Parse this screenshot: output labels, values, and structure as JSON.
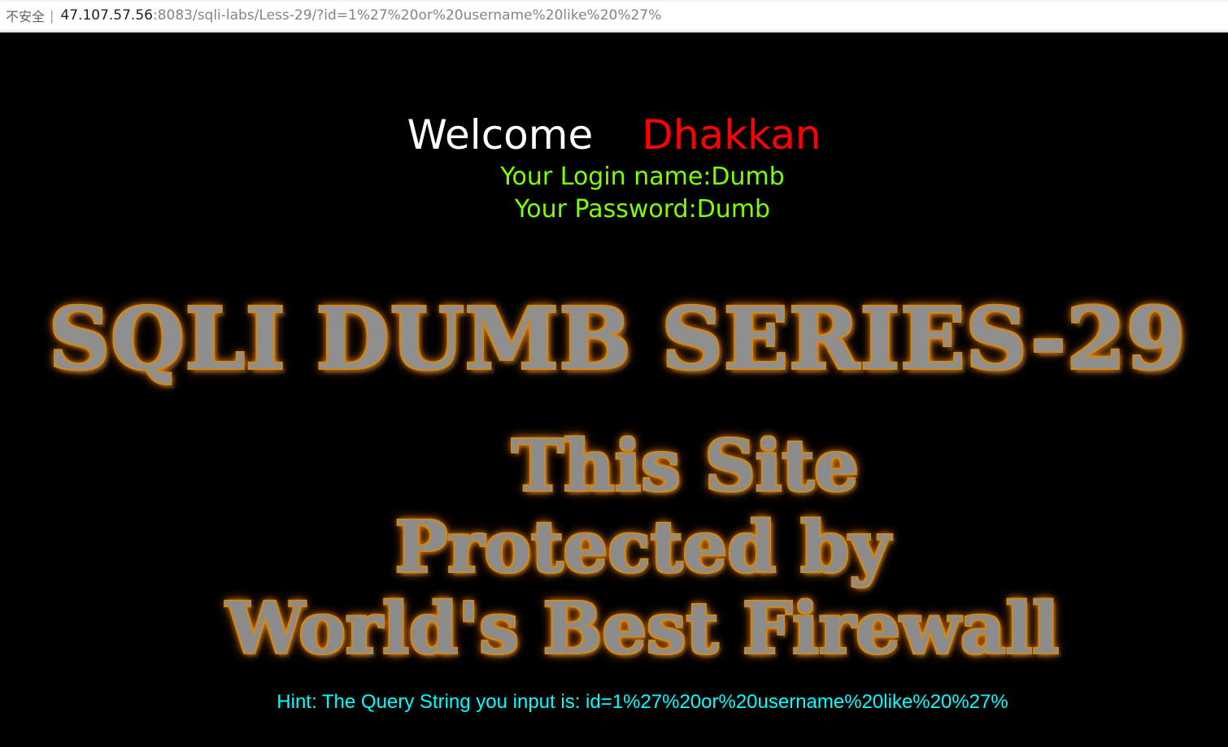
{
  "browser": {
    "security_label": "不安全",
    "separator": "|",
    "url_host": "47.107.57.56",
    "url_rest": ":8083/sqli-labs/Less-29/?id=1%27%20or%20username%20like%20%27%"
  },
  "page": {
    "welcome_word": "Welcome",
    "welcome_name": "Dhakkan",
    "login_name": "Your Login name:Dumb",
    "password": "Your Password:Dumb",
    "title": "SQLI DUMB SERIES-29",
    "protect_lines": [
      "This Site",
      "Protected by",
      "World's Best Firewall"
    ],
    "hint": "Hint: The Query String you input is: id=1%27%20or%20username%20like%20%27%"
  },
  "colors": {
    "background": "#000000",
    "welcome_word": "#ffffff",
    "welcome_name": "#ff0000",
    "login_info": "#7cff00",
    "hint": "#00ffff",
    "title_glow": "#ff8c1a"
  }
}
